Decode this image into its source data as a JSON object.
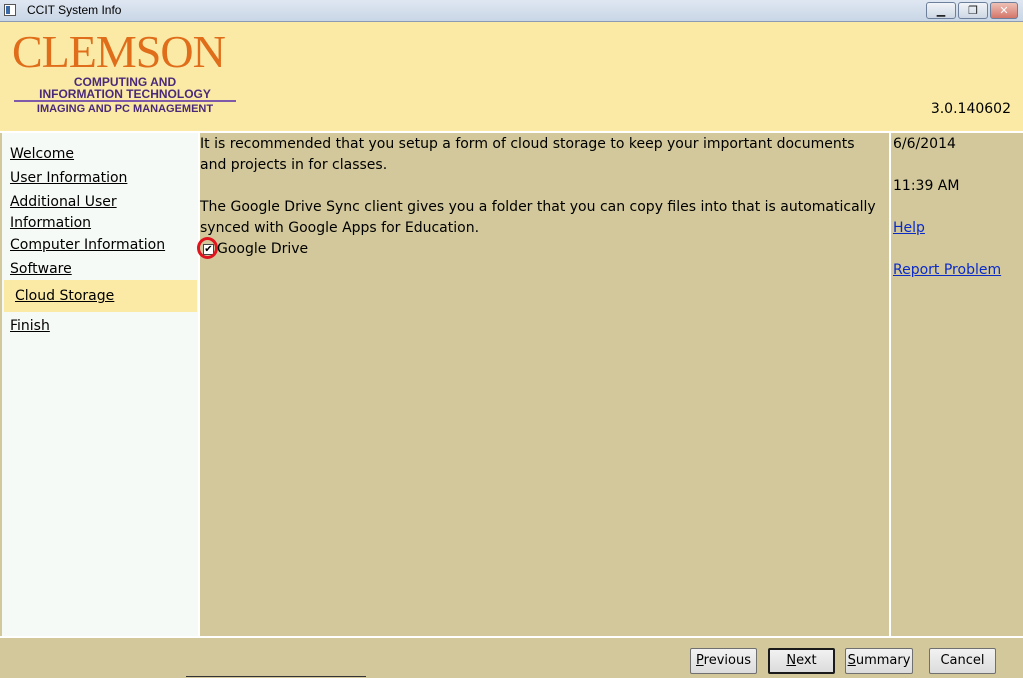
{
  "window": {
    "title": "CCIT System Info",
    "controls": {
      "minimize": "▁",
      "maximize": "❐",
      "close": "✕"
    }
  },
  "header": {
    "logo_word": "CLEMSON",
    "logo_line1": "COMPUTING AND",
    "logo_line2": "INFORMATION TECHNOLOGY",
    "logo_line3": "IMAGING AND PC MANAGEMENT",
    "version": "3.0.140602"
  },
  "nav": {
    "items": [
      {
        "label": "Welcome"
      },
      {
        "label": "User Information"
      },
      {
        "label": "Additional User Information"
      },
      {
        "label": "Computer Information"
      },
      {
        "label": "Software"
      },
      {
        "label": "Cloud Storage",
        "active": true
      },
      {
        "label": "Finish"
      }
    ]
  },
  "main": {
    "paragraph1": "It is recommended that you setup a form of cloud storage to keep your important documents and projects in for classes.",
    "paragraph2": "The Google Drive Sync client gives you a folder that you can copy files into that is automatically synced with Google Apps for Education.",
    "checkbox": {
      "label": "Google Drive",
      "checked": true,
      "mark": "✔"
    }
  },
  "side": {
    "date": "6/6/2014",
    "time": "11:39 AM",
    "help": "Help",
    "report": "Report Problem"
  },
  "footer": {
    "previous": {
      "first": "P",
      "rest": "revious"
    },
    "next": {
      "first": "N",
      "rest": "ext"
    },
    "summary": {
      "first": "S",
      "rest": "ummary"
    },
    "cancel": {
      "first": "",
      "rest": "Cancel"
    }
  },
  "colors": {
    "header_bg": "#faeaa6",
    "content_bg": "#d2c89b",
    "nav_bg": "#f6faf6",
    "logo_orange": "#e06d1a",
    "logo_purple": "#4a2a78",
    "link_blue": "#0a2ac8",
    "highlight_ring": "#e0141e"
  }
}
